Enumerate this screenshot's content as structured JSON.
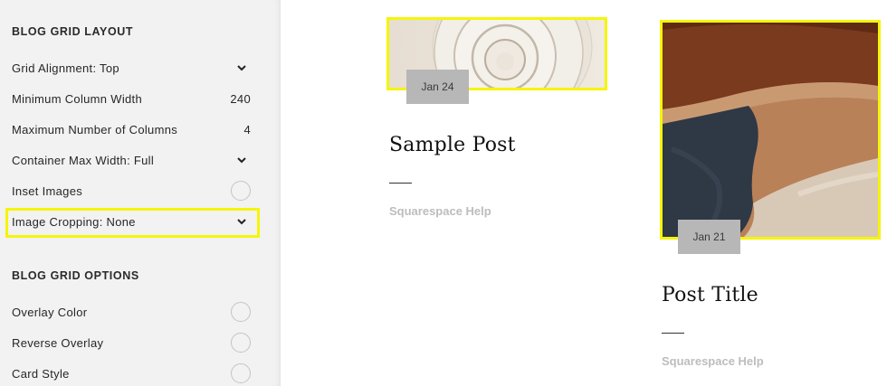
{
  "sidebar": {
    "layout_section": {
      "title": "BLOG GRID LAYOUT",
      "rows": [
        {
          "label": "Grid Alignment: Top",
          "control": "chevron-down-icon"
        },
        {
          "label": "Minimum Column Width",
          "value": "240"
        },
        {
          "label": "Maximum Number of Columns",
          "value": "4"
        },
        {
          "label": "Container Max Width: Full",
          "control": "chevron-down-icon"
        },
        {
          "label": "Inset Images",
          "control": "toggle",
          "on": false
        },
        {
          "label": "Image Cropping: None",
          "control": "chevron-down-icon",
          "highlighted": true
        }
      ]
    },
    "options_section": {
      "title": "BLOG GRID OPTIONS",
      "rows": [
        {
          "label": "Overlay Color",
          "control": "toggle",
          "on": false
        },
        {
          "label": "Reverse Overlay",
          "control": "toggle",
          "on": false
        },
        {
          "label": "Card Style",
          "control": "toggle",
          "on": false
        }
      ]
    }
  },
  "posts": [
    {
      "date": "Jan 24",
      "title": "Sample Post",
      "excerpt": "Squarespace Help",
      "image": "white-ceramic-plates",
      "highlighted": true
    },
    {
      "date": "Jan 21",
      "title": "Post Title",
      "excerpt": "Squarespace Help",
      "image": "clay-pot-closeup",
      "highlighted": true
    }
  ],
  "colors": {
    "highlight": "#f5f50a",
    "sidebar_bg": "#f2f2f2",
    "date_badge_bg": "#b7b7b7",
    "excerpt_text": "#bdbdbd"
  }
}
